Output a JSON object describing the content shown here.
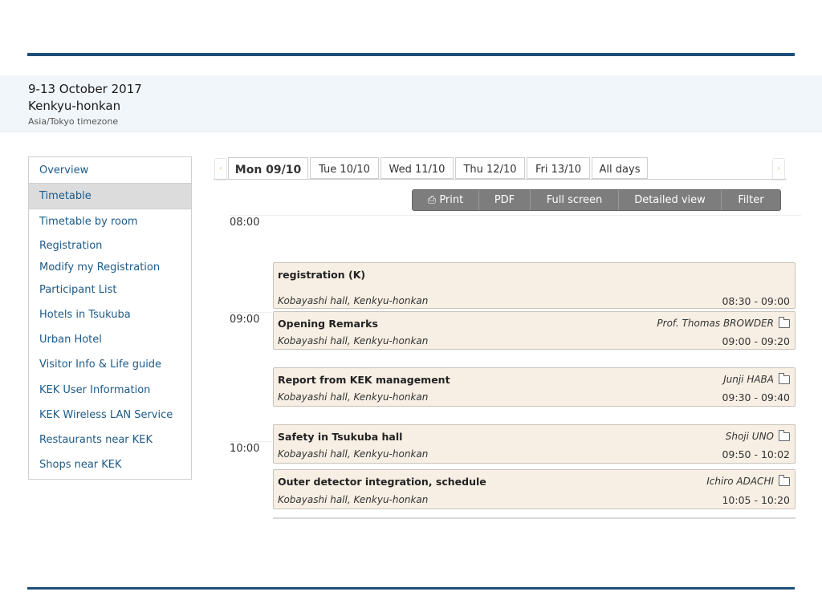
{
  "event": {
    "date": "9-13 October 2017",
    "venue": "Kenkyu-honkan",
    "timezone": "Asia/Tokyo timezone"
  },
  "menu": {
    "items": [
      {
        "label": "Overview"
      },
      {
        "label": "Timetable"
      },
      {
        "label": "Timetable by room"
      },
      {
        "label": "Registration"
      },
      {
        "label": "Modify my Registration"
      },
      {
        "label": "Participant List"
      },
      {
        "label": "Hotels in Tsukuba"
      },
      {
        "label": "Urban Hotel"
      },
      {
        "label": "Visitor Info & Life guide"
      },
      {
        "label": "KEK User Information"
      },
      {
        "label": "KEK Wireless LAN Service"
      },
      {
        "label": "Restaurants near KEK"
      },
      {
        "label": "Shops near KEK"
      }
    ],
    "active": "Timetable"
  },
  "tabs": [
    {
      "label": "Mon 09/10"
    },
    {
      "label": "Tue 10/10"
    },
    {
      "label": "Wed 11/10"
    },
    {
      "label": "Thu 12/10"
    },
    {
      "label": "Fri 13/10"
    },
    {
      "label": "All days"
    }
  ],
  "arrows": {
    "prev": "‹",
    "next": "›"
  },
  "toolbar": {
    "print_icon": "⎙",
    "print": "Print",
    "pdf": "PDF",
    "fullscreen": "Full screen",
    "detailed": "Detailed view",
    "filter": "Filter"
  },
  "hours": [
    "08:00",
    "09:00",
    "10:00"
  ],
  "contributions": [
    {
      "title": "registration (K)",
      "speaker": "",
      "room": "Kobayashi hall, Kenkyu-honkan",
      "time": "08:30 - 09:00"
    },
    {
      "title": "Opening Remarks",
      "speaker": "Prof. Thomas BROWDER",
      "room": "Kobayashi hall, Kenkyu-honkan",
      "time": "09:00 - 09:20"
    },
    {
      "title": "Report from KEK management",
      "speaker": "Junji HABA",
      "room": "Kobayashi hall, Kenkyu-honkan",
      "time": "09:30 - 09:40"
    },
    {
      "title": "Safety in Tsukuba hall",
      "speaker": "Shoji UNO",
      "room": "Kobayashi hall, Kenkyu-honkan",
      "time": "09:50 - 10:02"
    },
    {
      "title": "Outer detector integration, schedule",
      "speaker": "Ichiro ADACHI",
      "room": "Kobayashi hall, Kenkyu-honkan",
      "time": "10:05 - 10:20"
    }
  ]
}
